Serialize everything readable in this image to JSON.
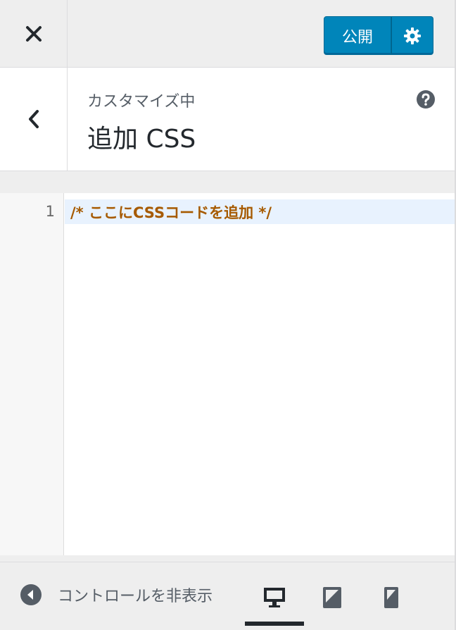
{
  "header": {
    "close_label": "×",
    "publish_label": "公開"
  },
  "section": {
    "customizing": "カスタマイズ中",
    "title": "追加 CSS"
  },
  "editor": {
    "line_number": "1",
    "code": "/* ここにCSSコードを追加 */"
  },
  "footer": {
    "collapse_label": "コントロールを非表示",
    "devices": [
      "desktop-icon",
      "tablet-icon",
      "mobile-icon"
    ],
    "active_device": "desktop"
  },
  "colors": {
    "primary": "#0085ba",
    "code_comment": "#a65a00",
    "active_line": "#e8f2fe"
  }
}
